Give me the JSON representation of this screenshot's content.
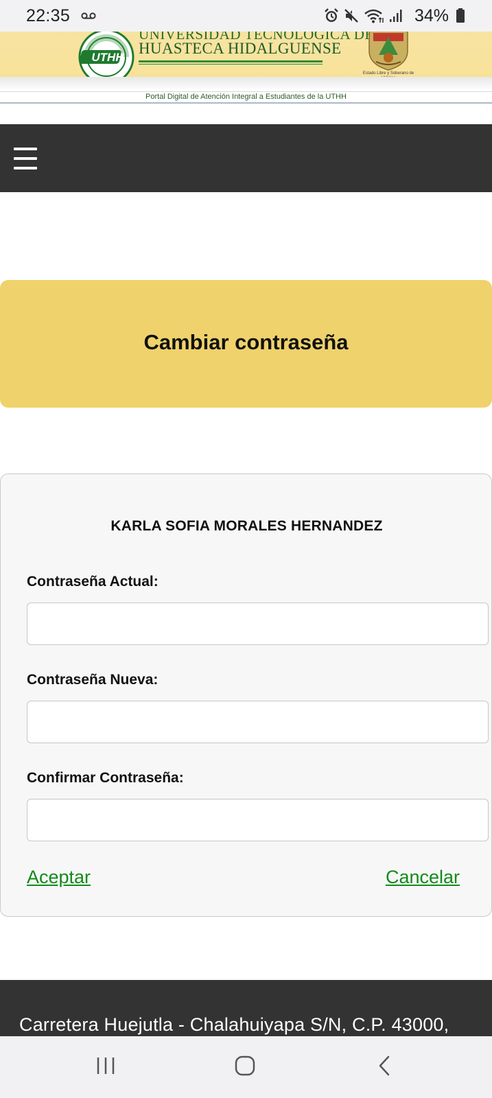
{
  "status_bar": {
    "time": "22:35",
    "battery": "34%"
  },
  "header": {
    "logo_text": "UTHH",
    "university_line1": "UNIVERSIDAD TECNOLÓGICA DE LA",
    "university_line2": "HUASTECA HIDALGUENSE",
    "seal_caption": "Estado Libre y Soberano de Hidalgo",
    "portal_subtitle": "Portal Digital de Atención Integral a Estudiantes de la UTHH"
  },
  "page": {
    "title": "Cambiar contraseña"
  },
  "form": {
    "student_name": "KARLA SOFIA MORALES HERNANDEZ",
    "current_password_label": "Contraseña Actual:",
    "current_password_value": "",
    "new_password_label": "Contraseña Nueva:",
    "new_password_value": "",
    "confirm_password_label": "Confirmar Contraseña:",
    "confirm_password_value": "",
    "accept_label": "Aceptar",
    "cancel_label": "Cancelar"
  },
  "footer": {
    "address": "Carretera Huejutla - Chalahuiyapa S/N, C.P. 43000,"
  },
  "icons": {
    "status": [
      "voicemail-icon",
      "alarm-icon",
      "mute-icon",
      "wifi-icon",
      "signal-icon",
      "battery-icon"
    ],
    "navigation": [
      "menu-icon",
      "recent-apps-icon",
      "home-icon",
      "back-icon"
    ]
  },
  "colors": {
    "banner_yellow": "#f9e39b",
    "title_card": "#efd26b",
    "navbar": "#333333",
    "link_green": "#128a1a",
    "brand_green": "#1d5b2a"
  }
}
